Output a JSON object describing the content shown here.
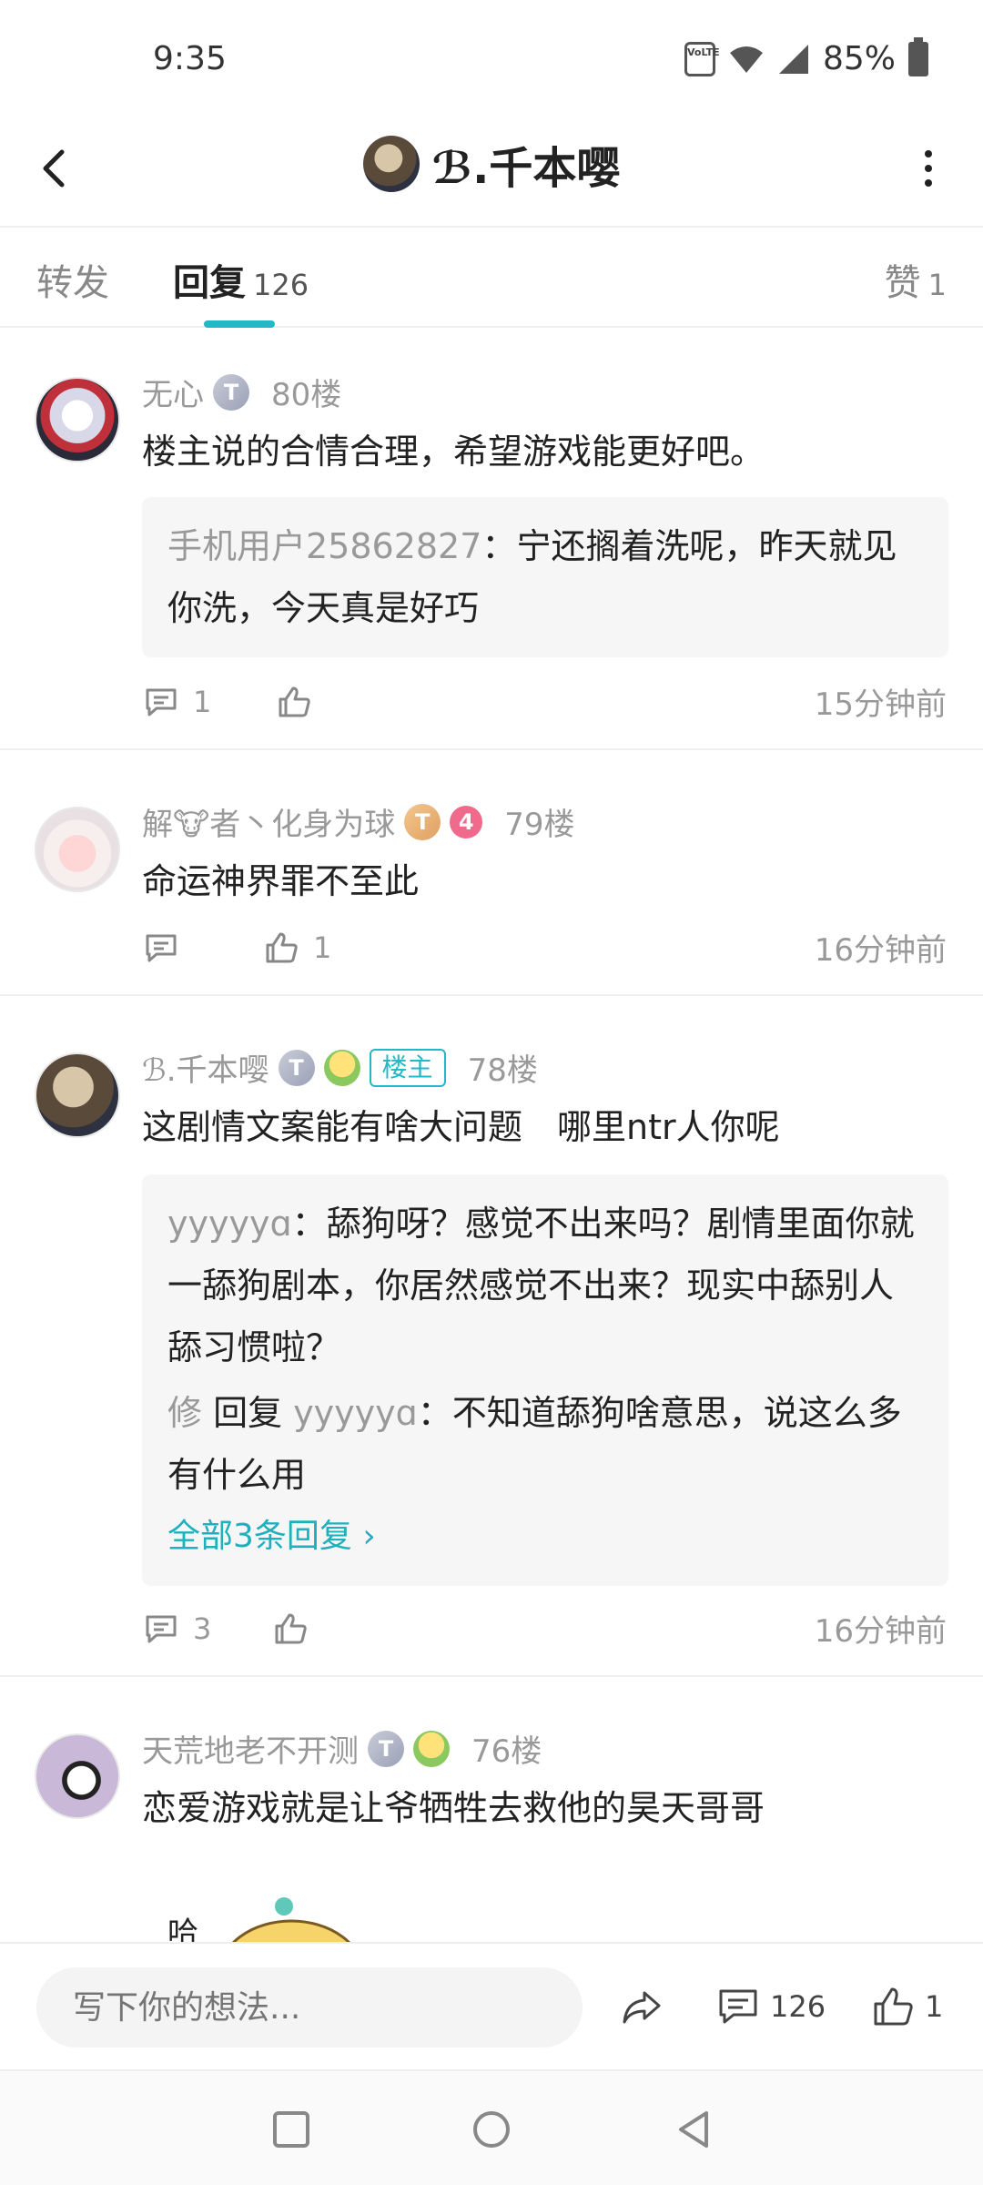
{
  "status": {
    "time": "9:35",
    "battery": "85%",
    "volte": "Vo LTE"
  },
  "header": {
    "title": "ℬ.千本嘤"
  },
  "tabs": [
    {
      "label": "转发"
    },
    {
      "label": "回复",
      "count": "126"
    },
    {
      "label": "赞",
      "count": "1"
    }
  ],
  "comments": [
    {
      "user": "无心",
      "floor": "80楼",
      "text": "楼主说的合情合理，希望游戏能更好吧。",
      "quote": [
        {
          "user": "手机用户25862827",
          "sep": "：",
          "text": "宁还搁着洗呢，昨天就见你洗，今天真是好巧"
        }
      ],
      "reply_count": "1",
      "like_count": "",
      "time": "15分钟前"
    },
    {
      "user_a": "解",
      "user_b": "者丶化身为球",
      "level": "4",
      "floor": "79楼",
      "text": "命运神界罪不至此",
      "reply_count": "",
      "like_count": "1",
      "time": "16分钟前"
    },
    {
      "user": "ℬ.千本嘤",
      "owner_tag": "楼主",
      "floor": "78楼",
      "text": "这剧情文案能有啥大问题　哪里ntr人你呢",
      "quote1_user": "yyyyyɑ",
      "quote1_sep": "：",
      "quote1_text": "舔狗呀？感觉不出来吗？剧情里面你就一舔狗剧本，你居然感觉不出来？现实中舔别人舔习惯啦？",
      "quote2_user": "修",
      "quote2_reply": " 回复 ",
      "quote2_target": "yyyyyɑ",
      "quote2_sep": "：",
      "quote2_text": "不知道舔狗啥意思，说这么多有什么用",
      "more_replies": "全部3条回复 ›",
      "reply_count": "3",
      "like_count": "",
      "time": "16分钟前"
    },
    {
      "user": "天荒地老不开测",
      "floor": "76楼",
      "text": "恋爱游戏就是让爷牺牲去救他的昊天哥哥",
      "sticker_text": "哈"
    }
  ],
  "input_bar": {
    "placeholder": "写下你的想法...",
    "reply_count": "126",
    "like_count": "1"
  },
  "colors": {
    "accent": "#22b8c5",
    "level_badge": "#f06a8c"
  }
}
